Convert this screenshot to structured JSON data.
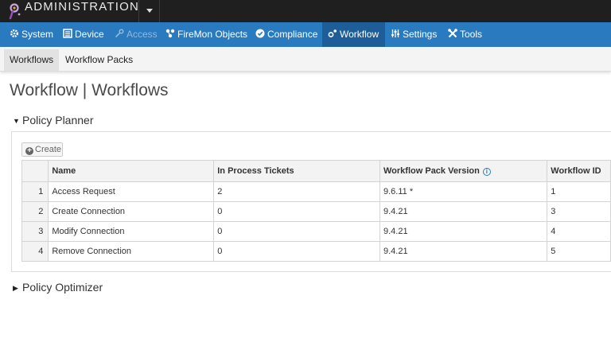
{
  "app": {
    "title": "ADMINISTRATION"
  },
  "nav": {
    "items": [
      {
        "label": "System",
        "icon": "gear-icon"
      },
      {
        "label": "Device",
        "icon": "list-icon"
      },
      {
        "label": "Access",
        "icon": "key-icon",
        "state": "disabled"
      },
      {
        "label": "FireMon Objects",
        "icon": "objects-icon"
      },
      {
        "label": "Compliance",
        "icon": "check-circle-icon"
      },
      {
        "label": "Workflow",
        "icon": "workflow-icon",
        "state": "active"
      },
      {
        "label": "Settings",
        "icon": "sliders-icon"
      },
      {
        "label": "Tools",
        "icon": "tools-icon"
      }
    ]
  },
  "subnav": {
    "tabs": [
      {
        "label": "Workflows",
        "state": "active"
      },
      {
        "label": "Workflow Packs"
      }
    ]
  },
  "page": {
    "title": "Workflow | Workflows"
  },
  "sections": [
    {
      "label": "Policy Planner",
      "expanded": true
    },
    {
      "label": "Policy Optimizer",
      "expanded": false
    }
  ],
  "planner": {
    "create_label": "Create",
    "columns": [
      "Name",
      "In Process Tickets",
      "Workflow Pack Version",
      "Workflow ID"
    ],
    "rows": [
      {
        "index": "1",
        "name": "Access Request",
        "tickets": "2",
        "version": "9.6.11 *",
        "id": "1"
      },
      {
        "index": "2",
        "name": "Create Connection",
        "tickets": "0",
        "version": "9.4.21",
        "id": "3"
      },
      {
        "index": "3",
        "name": "Modify Connection",
        "tickets": "0",
        "version": "9.4.21",
        "id": "4"
      },
      {
        "index": "4",
        "name": "Remove Connection",
        "tickets": "0",
        "version": "9.4.21",
        "id": "5"
      }
    ]
  },
  "colors": {
    "topbar": "#1f1f1f",
    "navbar": "#2a7ac0",
    "nav_active": "#1d5e99",
    "subnav": "#f4f4f4"
  }
}
